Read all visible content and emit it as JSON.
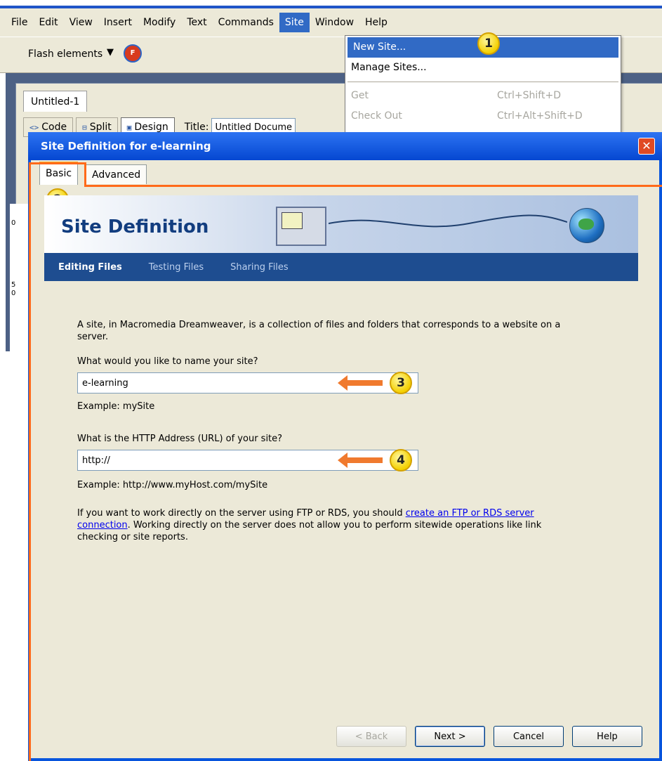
{
  "menubar": {
    "items": [
      "File",
      "Edit",
      "View",
      "Insert",
      "Modify",
      "Text",
      "Commands",
      "Site",
      "Window",
      "Help"
    ]
  },
  "toolbar": {
    "label": "Flash elements",
    "caret": "▼"
  },
  "document": {
    "tab": "Untitled-1",
    "views": [
      "Code",
      "Split",
      "Design"
    ],
    "title_label": "Title:",
    "title_value": "Untitled Document",
    "ruler_numbers": [
      "0",
      "5",
      "0"
    ]
  },
  "site_menu": {
    "items": [
      {
        "label": "New Site...",
        "shortcut": ""
      },
      {
        "label": "Manage Sites...",
        "shortcut": ""
      },
      {
        "label": "Get",
        "shortcut": "Ctrl+Shift+D"
      },
      {
        "label": "Check Out",
        "shortcut": "Ctrl+Alt+Shift+D"
      }
    ]
  },
  "dialog": {
    "title": "Site Definition for e-learning",
    "close": "✕",
    "tabs": [
      "Basic",
      "Advanced"
    ],
    "banner_title": "Site Definition",
    "subnav": [
      "Editing Files",
      "Testing Files",
      "Sharing Files"
    ],
    "intro": "A site, in Macromedia Dreamweaver, is a collection of files and folders that corresponds to a website on a server.",
    "name_question": "What would you like to name your site?",
    "name_value": "e-learning",
    "name_example": "Example: mySite",
    "url_question": "What is the HTTP Address (URL) of your site?",
    "url_value": "http://",
    "url_example": "Example: http://www.myHost.com/mySite",
    "ftp_text_before": "If you want to work directly on the server using FTP or RDS, you should ",
    "ftp_link": "create an FTP or RDS server connection",
    "ftp_text_after": ". Working directly on the server does not allow you to perform sitewide operations like link checking or site reports.",
    "buttons": [
      "< Back",
      "Next >",
      "Cancel",
      "Help"
    ]
  },
  "annotations": {
    "badges": [
      "1",
      "2",
      "3",
      "4"
    ],
    "color": "#ff6a1a"
  }
}
